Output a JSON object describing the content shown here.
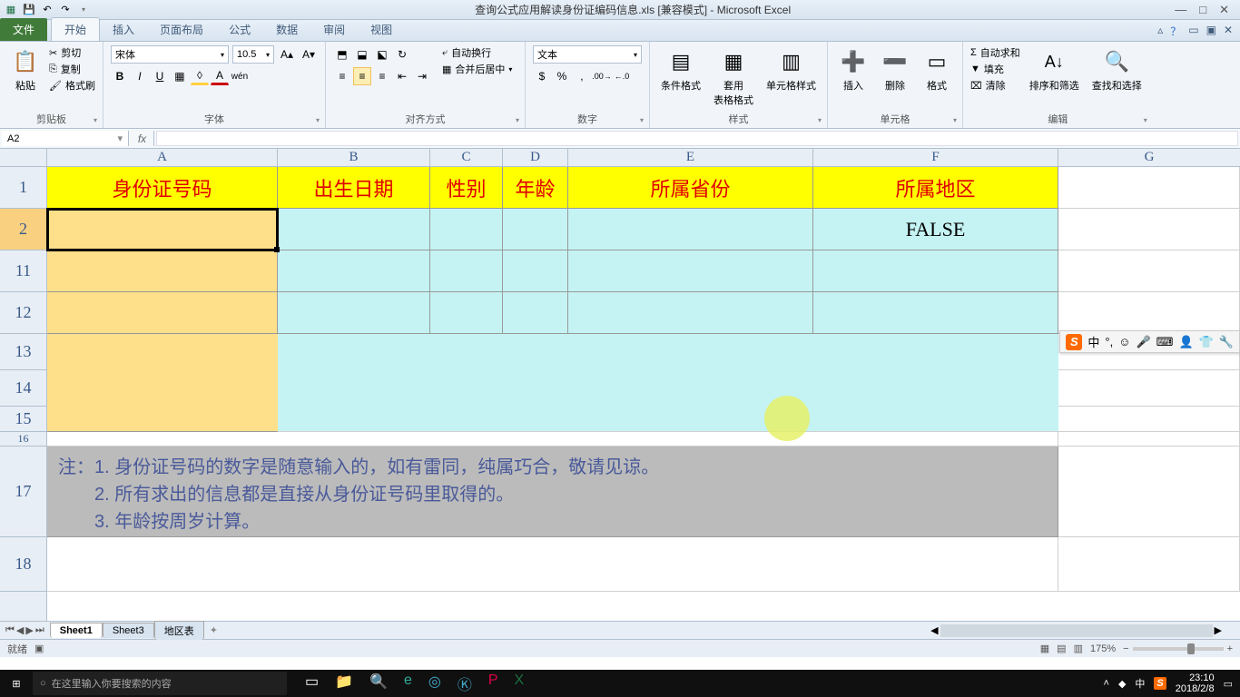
{
  "title": "查询公式应用解读身份证编码信息.xls  [兼容模式] - Microsoft Excel",
  "qat": {
    "save": "💾",
    "undo": "↶",
    "redo": "↷"
  },
  "tabs": {
    "file": "文件",
    "items": [
      "开始",
      "插入",
      "页面布局",
      "公式",
      "数据",
      "审阅",
      "视图"
    ],
    "active": 0,
    "help": "？"
  },
  "ribbon": {
    "clipboard": {
      "paste": "粘贴",
      "cut": "剪切",
      "copy": "复制",
      "painter": "格式刷",
      "label": "剪贴板"
    },
    "font": {
      "name": "宋体",
      "size": "10.5",
      "label": "字体"
    },
    "align": {
      "wrap": "自动换行",
      "merge": "合并后居中",
      "label": "对齐方式"
    },
    "number": {
      "format": "文本",
      "label": "数字"
    },
    "styles": {
      "cond": "条件格式",
      "table": "套用\n表格格式",
      "cell": "单元格样式",
      "label": "样式"
    },
    "cells": {
      "insert": "插入",
      "delete": "删除",
      "format": "格式",
      "label": "单元格"
    },
    "editing": {
      "sum": "自动求和",
      "fill": "填充",
      "clear": "清除",
      "sort": "排序和筛选",
      "find": "查找和选择",
      "label": "编辑"
    }
  },
  "namebox": "A2",
  "columns": [
    "A",
    "B",
    "C",
    "D",
    "E",
    "F",
    "G"
  ],
  "rows": [
    "1",
    "2",
    "11",
    "12",
    "13",
    "14",
    "15",
    "16",
    "17",
    "18"
  ],
  "headers": {
    "A": "身份证号码",
    "B": "出生日期",
    "C": "性别",
    "D": "年龄",
    "E": "所属省份",
    "F": "所属地区"
  },
  "data": {
    "F2": "FALSE"
  },
  "chart_data": {
    "type": "table",
    "columns": [
      "身份证号码",
      "出生日期",
      "性别",
      "年龄",
      "所属省份",
      "所属地区"
    ],
    "rows": [
      {
        "身份证号码": "",
        "出生日期": "",
        "性别": "",
        "年龄": "",
        "所属省份": "",
        "所属地区": "FALSE"
      },
      {
        "身份证号码": "",
        "出生日期": "",
        "性别": "",
        "年龄": "",
        "所属省份": "",
        "所属地区": ""
      },
      {
        "身份证号码": "",
        "出生日期": "",
        "性别": "",
        "年龄": "",
        "所属省份": "",
        "所属地区": ""
      }
    ]
  },
  "note": {
    "l1": "注：1. 身份证号码的数字是随意输入的，如有雷同，纯属巧合，敬请见谅。",
    "l2": "　　2. 所有求出的信息都是直接从身份证号码里取得的。",
    "l3": "　　3. 年龄按周岁计算。"
  },
  "sheets": [
    "Sheet1",
    "Sheet3",
    "地区表"
  ],
  "status": {
    "ready": "就绪",
    "zoom": "175%"
  },
  "ime": {
    "lang": "中",
    "punct": "°,"
  },
  "taskbar": {
    "search": "在这里输入你要搜索的内容",
    "time": "23:10",
    "date": "2018/2/8",
    "lang": "中"
  }
}
